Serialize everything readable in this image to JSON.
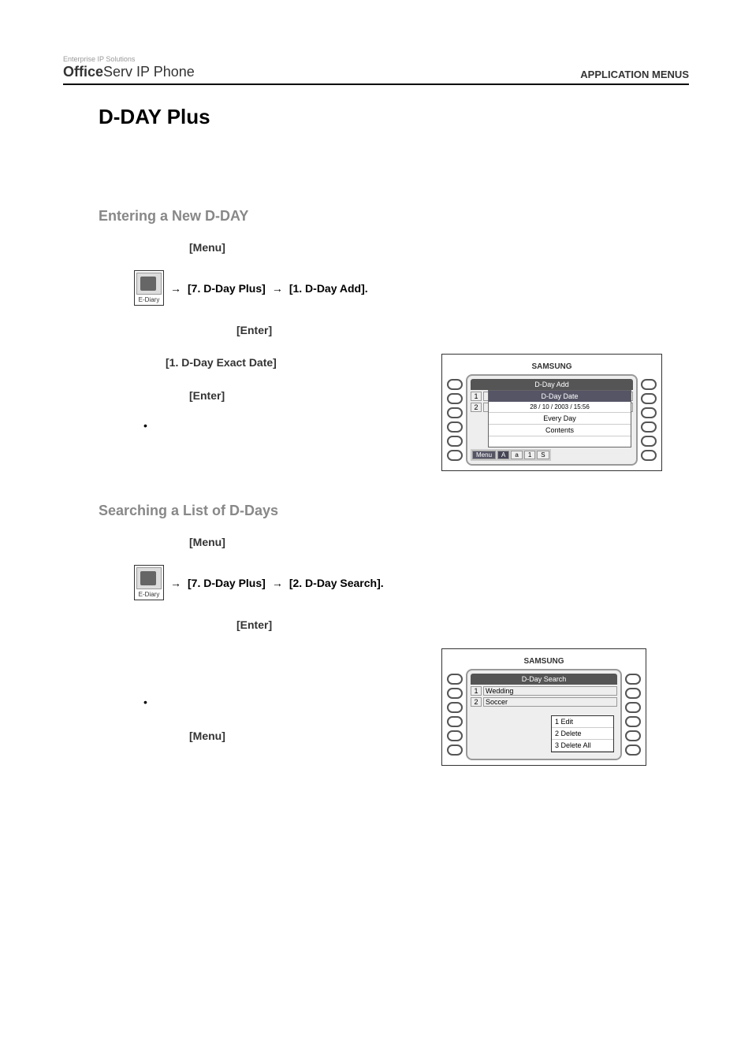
{
  "header": {
    "logo_tiny": "Enterprise IP Solutions",
    "logo_bold": "Office",
    "logo_rest": "Serv IP Phone",
    "right": "APPLICATION MENUS"
  },
  "title": "D-DAY Plus",
  "section1": {
    "heading": "Entering a New D-DAY",
    "menu_label": "[Menu]",
    "nav1": "[7. D-Day Plus]",
    "nav2": "[1. D-Day Add].",
    "ediary": "E-Diary",
    "arrow": "→",
    "enter": "[Enter]",
    "exact_date": "[1. D-Day Exact Date]"
  },
  "phone1": {
    "brand": "SAMSUNG",
    "title": "D-Day Add",
    "dialog_title": "D-Day Date",
    "date": "28 / 10 / 2003 / 15:56",
    "every": "Every Day",
    "contents": "Contents",
    "menu": "Menu",
    "mode_a": "A",
    "mode_a2": "a",
    "mode_1": "1",
    "mode_s": "S"
  },
  "section2": {
    "heading": "Searching a List of D-Days",
    "menu_label": "[Menu]",
    "nav1": "[7. D-Day Plus]",
    "nav2": "[2. D-Day Search].",
    "ediary": "E-Diary",
    "arrow": "→",
    "enter": "[Enter]",
    "menu2": "[Menu]"
  },
  "phone2": {
    "brand": "SAMSUNG",
    "title": "D-Day Search",
    "item1": "Wedding",
    "item2": "Soccer",
    "popup1": "1  Edit",
    "popup2": "2  Delete",
    "popup3": "3  Delete All"
  }
}
